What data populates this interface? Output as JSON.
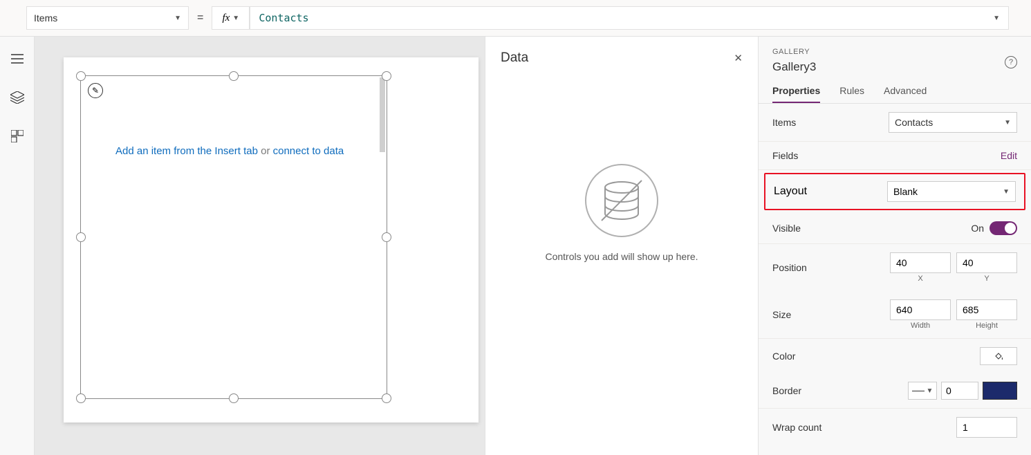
{
  "formula_bar": {
    "property": "Items",
    "equals": "=",
    "fx": "fx",
    "value": "Contacts"
  },
  "canvas": {
    "hint_prefix": "Add an item from the Insert tab ",
    "hint_mid": "or ",
    "hint_link": "connect to data"
  },
  "data_pane": {
    "title": "Data",
    "empty_text": "Controls you add will show up here."
  },
  "props": {
    "type": "GALLERY",
    "name": "Gallery3",
    "tabs": {
      "properties": "Properties",
      "rules": "Rules",
      "advanced": "Advanced"
    },
    "items_label": "Items",
    "items_value": "Contacts",
    "fields_label": "Fields",
    "fields_link": "Edit",
    "layout_label": "Layout",
    "layout_value": "Blank",
    "visible_label": "Visible",
    "visible_value": "On",
    "position_label": "Position",
    "pos_x": "40",
    "pos_y": "40",
    "lbl_x": "X",
    "lbl_y": "Y",
    "size_label": "Size",
    "size_w": "640",
    "size_h": "685",
    "lbl_w": "Width",
    "lbl_h": "Height",
    "color_label": "Color",
    "border_label": "Border",
    "border_value": "0",
    "wrap_label": "Wrap count",
    "wrap_value": "1"
  }
}
